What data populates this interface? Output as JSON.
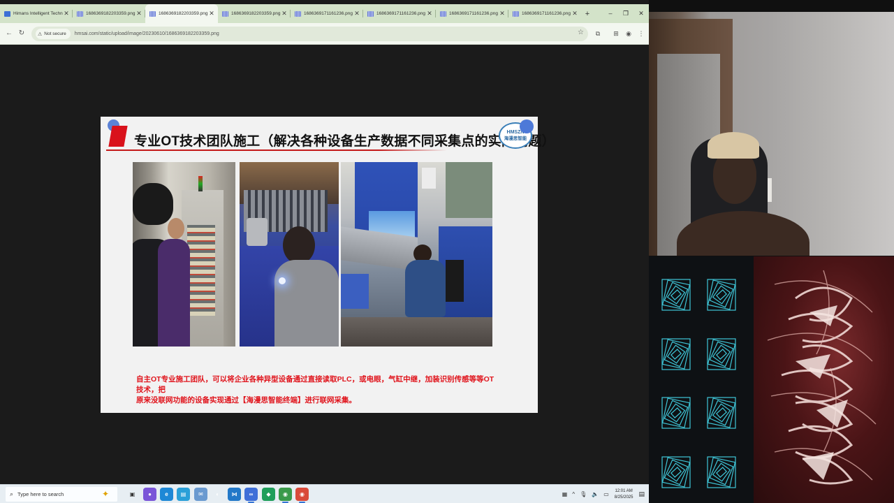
{
  "browser": {
    "tabs": [
      {
        "title": "Himans Intelligent Technolo",
        "active": false,
        "brand": true
      },
      {
        "title": "1686369182203359.png (1",
        "active": false
      },
      {
        "title": "1686369182203359.png (1",
        "active": true
      },
      {
        "title": "1686369182203359.png (1",
        "active": false
      },
      {
        "title": "1686369171161236.png (1",
        "active": false
      },
      {
        "title": "1686369171161236.png (1",
        "active": false
      },
      {
        "title": "1686369171161236.png (1",
        "active": false
      },
      {
        "title": "1686369171161236.png (1",
        "active": false
      }
    ],
    "new_tab_label": "+",
    "window_controls": {
      "minimize": "–",
      "restore": "❐",
      "close": "✕"
    },
    "toolbar": {
      "back_icon": "←",
      "reload_icon": "↻",
      "security_label": "Not secure",
      "url": "hmsai.com/static/upload/image/20230610/1686369182203359.png",
      "star_icon": "☆"
    }
  },
  "slide": {
    "title": "专业OT技术团队施工（解决各种设备生产数据不同采集点的实际问题）",
    "logo_text_en": "HMSZN",
    "logo_text_cn": "海漫思智能",
    "caption_line1": "自主OT专业施工团队，可以将企业各种异型设备通过直接读取PLC，或电眼，气缸中继，加装识别传感等等OT技术，把",
    "caption_line2": "原来没联网功能的设备实现通过【海漫思智能终端】进行联网采集。",
    "colors": {
      "accent": "#d9121b",
      "caption": "#e0141c",
      "logo": "#2b6aa3"
    }
  },
  "taskbar": {
    "search_placeholder": "Type here to search",
    "clock_time": "12:01 AM",
    "clock_date": "8/25/2025",
    "apps": [
      {
        "name": "task-view",
        "glyph": "▣",
        "color": "#3b3b3b"
      },
      {
        "name": "app-orb",
        "glyph": "●",
        "color": "#7a55d8"
      },
      {
        "name": "edge",
        "glyph": "e",
        "color": "#1e88d6"
      },
      {
        "name": "files",
        "glyph": "▤",
        "color": "#2aa0d8"
      },
      {
        "name": "mail",
        "glyph": "✉",
        "color": "#6a9ad0"
      },
      {
        "name": "vscode",
        "glyph": "⋈",
        "color": "#2278c8"
      },
      {
        "name": "meta",
        "glyph": "∞",
        "color": "#3f6fd8"
      },
      {
        "name": "app-green",
        "glyph": "◆",
        "color": "#1f9e5a"
      },
      {
        "name": "chrome-a",
        "glyph": "◉",
        "color": "#3a9a4a"
      },
      {
        "name": "chrome-b",
        "glyph": "◉",
        "color": "#d94a3a"
      }
    ],
    "tray_icons": [
      "▦",
      "^",
      "🎤",
      "🔊",
      "▭"
    ]
  }
}
